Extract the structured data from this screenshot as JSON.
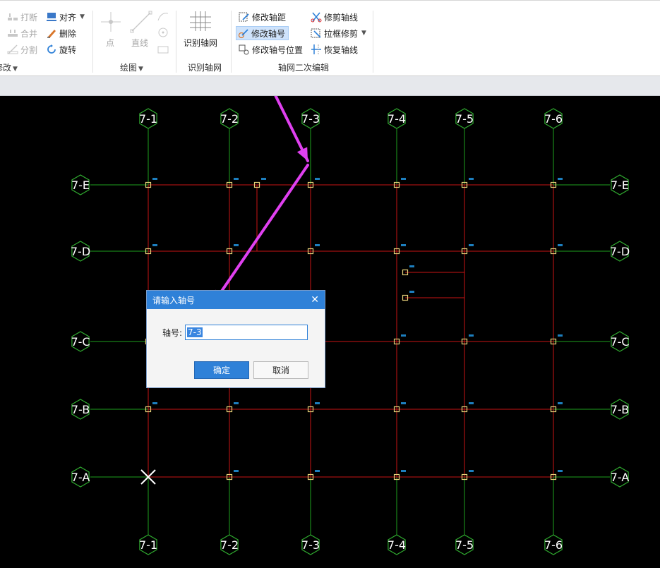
{
  "ribbon": {
    "modify_group": {
      "break_label": "打断",
      "merge_label": "合并",
      "split_label": "分割",
      "align_label": "对齐",
      "delete_label": "删除",
      "rotate_label": "旋转",
      "group_label": "修改"
    },
    "draw_group": {
      "point_label": "点",
      "line_label": "直线",
      "group_label": "绘图"
    },
    "identify_group": {
      "identify_label": "识别轴网",
      "group_label": "识别轴网"
    },
    "edit_group": {
      "modify_spacing_label": "修改轴距",
      "modify_number_label": "修改轴号",
      "modify_number_pos_label": "修改轴号位置",
      "trim_axis_label": "修剪轴线",
      "box_trim_label": "拉框修剪",
      "restore_axis_label": "恢复轴线",
      "group_label": "轴网二次编辑"
    }
  },
  "grid": {
    "top_labels": [
      "7-1",
      "7-2",
      "7-3",
      "7-4",
      "7-5",
      "7-6"
    ],
    "bottom_labels": [
      "7-1",
      "7-2",
      "7-3",
      "7-4",
      "7-5",
      "7-6"
    ],
    "left_labels": [
      "7-E",
      "7-D",
      "7-C",
      "7-B",
      "7-A"
    ],
    "right_labels": [
      "7-E",
      "7-D",
      "7-C",
      "7-B",
      "7-A"
    ]
  },
  "dialog": {
    "title": "请输入轴号",
    "close_glyph": "✕",
    "field_label": "轴号:",
    "field_value": "7-3",
    "ok_label": "确定",
    "cancel_label": "取消"
  },
  "colors": {
    "axis_red": "#c81414",
    "axis_green": "#1ea01e",
    "bubble": "#2fa82f",
    "node_yellow": "#e8d27a",
    "arrow_magenta": "#e040f0",
    "dialog_blue": "#2f81d8"
  }
}
